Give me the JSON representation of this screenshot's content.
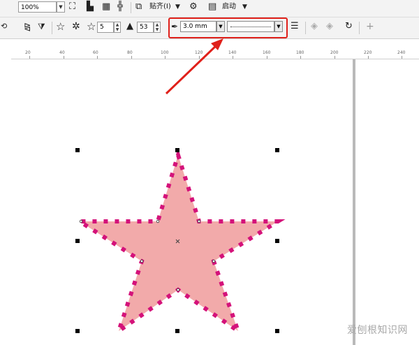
{
  "toolbar_top": {
    "zoom_value": "100%",
    "snap_label": "贴齐(I)",
    "launch_label": "启动"
  },
  "property_bar": {
    "points_value": "5",
    "sharpness_value": "53",
    "outline_width_value": "3.0 mm",
    "line_style": "dotted"
  },
  "ruler": {
    "labels": [
      "20",
      "40",
      "60",
      "80",
      "100",
      "120",
      "140",
      "160",
      "180",
      "200",
      "220",
      "240"
    ]
  },
  "shape": {
    "type": "star",
    "fill_color": "#f2aaaa",
    "outline_color": "#d4127a",
    "outline_style": "dotted"
  },
  "annotation": {
    "highlight_color": "#e0201a"
  },
  "watermark": {
    "text": "爱刨根知识网"
  }
}
